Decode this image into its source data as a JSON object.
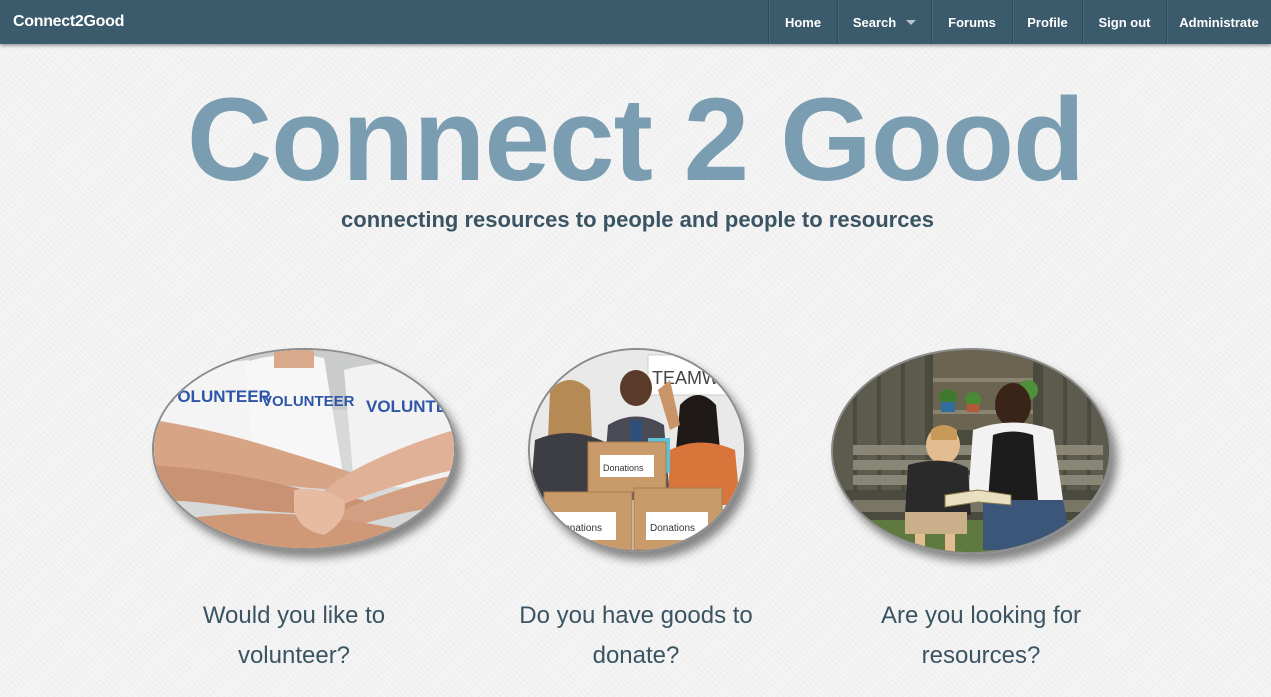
{
  "navbar": {
    "brand": "Connect2Good",
    "items": [
      {
        "label": "Home"
      },
      {
        "label": "Search",
        "dropdown": true
      },
      {
        "label": "Forums"
      },
      {
        "label": "Profile"
      },
      {
        "label": "Sign out"
      },
      {
        "label": "Administrate"
      }
    ]
  },
  "hero": {
    "title": "Connect 2 Good",
    "subtitle": "connecting resources to people and people to resources"
  },
  "cards": [
    {
      "image_text": [
        "VOLUNTEER",
        "VOLUNTEER",
        "VOLUNTEER"
      ],
      "caption_line1": "Would you like to",
      "caption_line2": "volunteer?"
    },
    {
      "image_text": [
        "TEAMWO",
        "Donations",
        "Donations",
        "Donations"
      ],
      "caption_line1": "Do you have goods to",
      "caption_line2": "donate?"
    },
    {
      "image_text": [],
      "caption_line1": "Are you looking for",
      "caption_line2": "resources?"
    }
  ],
  "colors": {
    "navbar_bg": "#3b5a6b",
    "title": "#7a9db2",
    "text": "#3b5463",
    "background": "#f1f2f1"
  }
}
